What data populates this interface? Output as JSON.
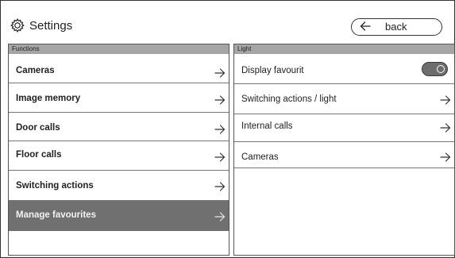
{
  "header": {
    "title": "Settings",
    "title_icon": "gear-icon",
    "back_label": "back",
    "back_icon": "arrow-left-icon"
  },
  "left_panel": {
    "heading": "Functions",
    "items": [
      {
        "label": "Cameras",
        "selected": false
      },
      {
        "label": "Image memory",
        "selected": false
      },
      {
        "label": "Door calls",
        "selected": false
      },
      {
        "label": "Floor calls",
        "selected": false
      },
      {
        "label": "Switching actions",
        "selected": false
      },
      {
        "label": "Manage favourites",
        "selected": true
      }
    ]
  },
  "right_panel": {
    "heading": "Light",
    "items": [
      {
        "label": "Display favourit",
        "control": "toggle",
        "toggle_on": true
      },
      {
        "label": "Switching actions / light",
        "control": "arrow"
      },
      {
        "label": "Internal calls",
        "control": "arrow"
      },
      {
        "label": "Cameras",
        "control": "arrow"
      }
    ]
  },
  "colors": {
    "panel_header": "#a5a5a5",
    "selected_row": "#707070",
    "toggle_bg": "#6d6d6d"
  }
}
